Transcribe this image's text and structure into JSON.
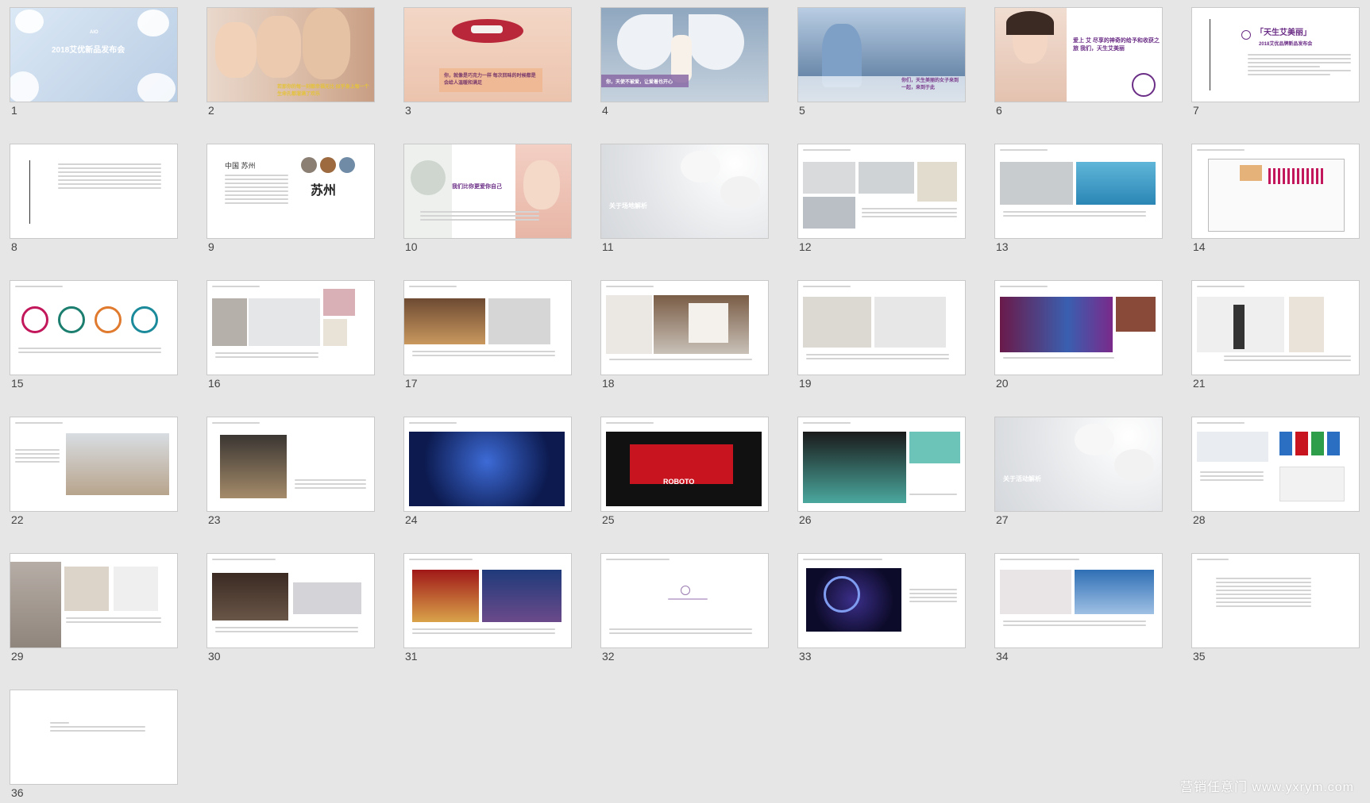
{
  "slides": [
    {
      "n": "1",
      "title": "2018艾优新品发布会",
      "sub": "AIO"
    },
    {
      "n": "2",
      "caption": "若那你的每一刻都幸福无比 似乎身上每一个生命孔都溜满了欢乐"
    },
    {
      "n": "3",
      "caption": "你，就像是巧克力一样 每次回味的时候都是会给人温暖和满足"
    },
    {
      "n": "4",
      "caption": "你，天使不被爱，让爱着也开心"
    },
    {
      "n": "5",
      "caption": "你们，天生美丽的女子来到一起，来到于此"
    },
    {
      "n": "6",
      "caption": "爱上 艾 尽享的神奇的给予和收获之旅 我们，天生艾美丽"
    },
    {
      "n": "7",
      "title": "「天生艾美丽」",
      "sub": "2018艾优品牌新品发布会"
    },
    {
      "n": "8"
    },
    {
      "n": "9",
      "title": "中国 苏州",
      "sub": "苏州"
    },
    {
      "n": "10",
      "caption": "我们比你更爱你自己"
    },
    {
      "n": "11",
      "caption": "关于场地解析"
    },
    {
      "n": "12"
    },
    {
      "n": "13"
    },
    {
      "n": "14"
    },
    {
      "n": "15"
    },
    {
      "n": "16"
    },
    {
      "n": "17"
    },
    {
      "n": "18"
    },
    {
      "n": "19"
    },
    {
      "n": "20"
    },
    {
      "n": "21"
    },
    {
      "n": "22"
    },
    {
      "n": "23"
    },
    {
      "n": "24"
    },
    {
      "n": "25",
      "caption": "ROBOTO"
    },
    {
      "n": "26"
    },
    {
      "n": "27",
      "caption": "关于活动解析"
    },
    {
      "n": "28"
    },
    {
      "n": "29"
    },
    {
      "n": "30"
    },
    {
      "n": "31"
    },
    {
      "n": "32"
    },
    {
      "n": "33"
    },
    {
      "n": "34"
    },
    {
      "n": "35"
    },
    {
      "n": "36"
    }
  ],
  "watermark": "营销任意门 www.yxrym.com"
}
